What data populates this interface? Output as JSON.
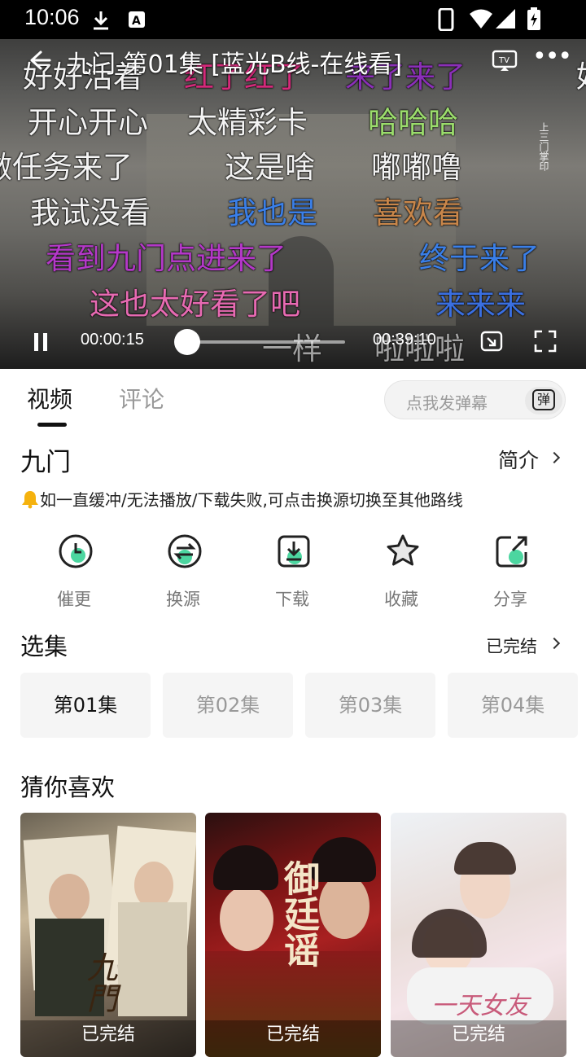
{
  "status_bar": {
    "time": "10:06"
  },
  "player": {
    "title": "九门 第01集 [蓝光B线-在线看]",
    "seal_text": "上三门掌印",
    "current_time": "00:00:15",
    "total_time": "00:39:10",
    "progress_fraction": 0.006,
    "danmaku": [
      {
        "text": "好好活着",
        "color": "#f3f3f3"
      },
      {
        "text": "红了红了",
        "color": "#d32a7a"
      },
      {
        "text": "来了来了",
        "color": "#8b2fb8"
      },
      {
        "text": "好",
        "color": "#f3f3f3"
      },
      {
        "text": "开心开心",
        "color": "#f3f3f3"
      },
      {
        "text": "太精彩卡",
        "color": "#f3f3f3"
      },
      {
        "text": "哈哈哈",
        "color": "#9bdc6c"
      },
      {
        "text": "做任务来了",
        "color": "#f3f3f3"
      },
      {
        "text": "这是啥",
        "color": "#f3f3f3"
      },
      {
        "text": "嘟嘟噜",
        "color": "#f3f3f3"
      },
      {
        "text": "我试没看",
        "color": "#f3f3f3"
      },
      {
        "text": "我也是",
        "color": "#3a7fe8"
      },
      {
        "text": "喜欢看",
        "color": "#c8864a"
      },
      {
        "text": "看到九门点进来了",
        "color": "#b438c8"
      },
      {
        "text": "终于来了",
        "color": "#3a7fe8"
      },
      {
        "text": "这也太好看了吧",
        "color": "#e76ab2"
      },
      {
        "text": "来来来",
        "color": "#3a6fe0"
      },
      {
        "text": "一样",
        "color": "#f3f3f3"
      },
      {
        "text": "啦啦啦",
        "color": "#f3f3f3"
      }
    ]
  },
  "tabs": {
    "video": "视频",
    "comments": "评论"
  },
  "danmaku_input": {
    "placeholder": "点我发弹幕",
    "icon_label": "弹"
  },
  "show": {
    "name": "九门",
    "intro_label": "简介",
    "notice_icon": "bell-icon",
    "notice": "如一直缓冲/无法播放/下载失败,可点击换源切换至其他路线"
  },
  "actions": [
    {
      "label": "催更",
      "icon": "clock-icon"
    },
    {
      "label": "换源",
      "icon": "switch-source-icon"
    },
    {
      "label": "下载",
      "icon": "download-icon"
    },
    {
      "label": "收藏",
      "icon": "star-icon"
    },
    {
      "label": "分享",
      "icon": "share-icon"
    }
  ],
  "episodes": {
    "title": "选集",
    "status": "已完结",
    "items": [
      "第01集",
      "第02集",
      "第03集",
      "第04集"
    ],
    "selected": 0
  },
  "recommend": {
    "title": "猜你喜欢",
    "items": [
      {
        "tag": "已完结",
        "poster_text": "九門"
      },
      {
        "tag": "已完结",
        "poster_text": "御廷谣"
      },
      {
        "tag": "已完结",
        "poster_text": "一天女友"
      }
    ]
  },
  "colors": {
    "accent_green": "#4cd6a0",
    "text_primary": "#111111",
    "text_muted": "#999999"
  }
}
